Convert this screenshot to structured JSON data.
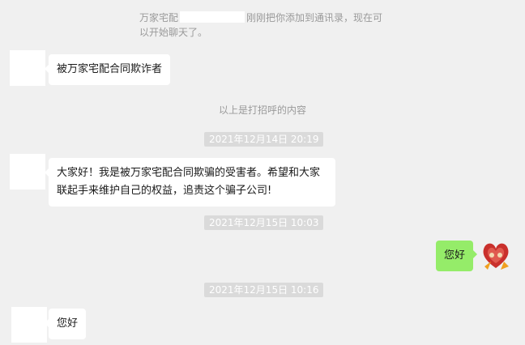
{
  "system_message": {
    "prefix": "万家宅配",
    "suffix": "刚刚把你添加到通讯录，现在可以开始聊天了。"
  },
  "greeting_notice": "以上是打招呼的内容",
  "messages": [
    {
      "text": "被万家宅配合同欺诈者",
      "direction": "incoming"
    },
    {
      "text": "大家好！我是被万家宅配合同欺骗的受害者。希望和大家联起手来维护自己的权益，追责这个骗子公司!",
      "direction": "incoming"
    },
    {
      "text": "您好",
      "direction": "outgoing"
    },
    {
      "text": "您好",
      "direction": "incoming"
    }
  ],
  "timestamps": [
    "2021年12月14日 20:19",
    "2021年12月15日 10:03",
    "2021年12月15日 10:16"
  ],
  "colors": {
    "background": "#f0f0f0",
    "incoming_bubble": "#ffffff",
    "outgoing_bubble": "#95ec69",
    "timestamp_chip": "#dadada"
  },
  "icons": {
    "self_avatar": "heart-couple-avatar-icon"
  }
}
